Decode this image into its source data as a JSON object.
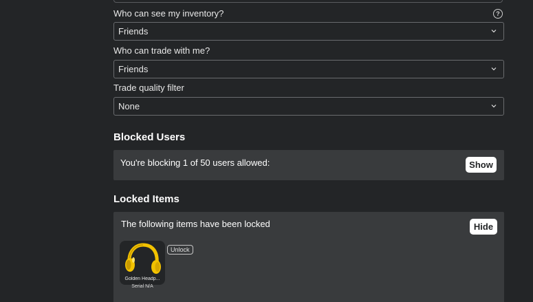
{
  "settings": {
    "inventory": {
      "label": "Who can see my inventory?",
      "value": "Friends",
      "help_icon": "question-circle-icon",
      "help_glyph": "?"
    },
    "trade": {
      "label": "Who can trade with me?",
      "value": "Friends"
    },
    "trade_quality": {
      "label": "Trade quality filter",
      "value": "None"
    }
  },
  "blocked_users": {
    "title": "Blocked Users",
    "text": "You're blocking 1 of 50 users allowed:",
    "button_label": "Show"
  },
  "locked_items": {
    "title": "Locked Items",
    "text": "The following items have been locked",
    "button_label": "Hide",
    "items": [
      {
        "name": "Golden Headp...",
        "serial": "Serial N/A",
        "unlock_label": "Unlock",
        "icon": "golden-headphones-icon"
      }
    ]
  },
  "colors": {
    "background": "#232527",
    "panel": "#393b3d",
    "border": "#6a6c6f",
    "headphones_gold": "#f2c200"
  }
}
